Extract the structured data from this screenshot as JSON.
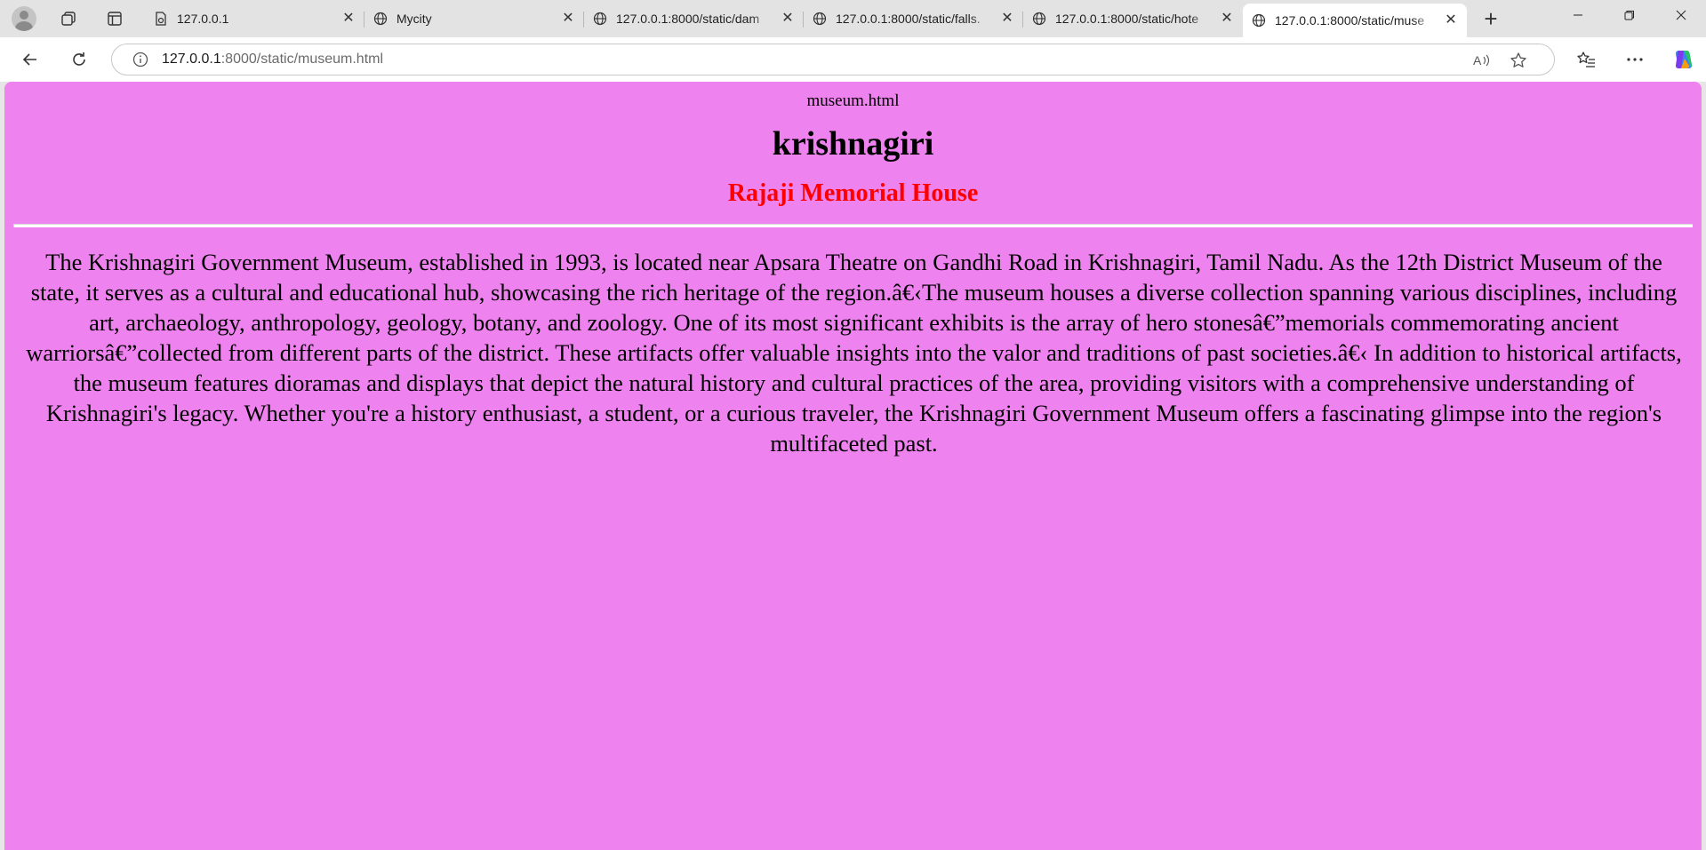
{
  "browser": {
    "tabs": [
      {
        "title": "127.0.0.1",
        "icon": "page-icon"
      },
      {
        "title": "Mycity",
        "icon": "globe-icon"
      },
      {
        "title": "127.0.0.1:8000/static/dam",
        "icon": "globe-icon"
      },
      {
        "title": "127.0.0.1:8000/static/falls.",
        "icon": "globe-icon"
      },
      {
        "title": "127.0.0.1:8000/static/hote",
        "icon": "globe-icon"
      },
      {
        "title": "127.0.0.1:8000/static/muse",
        "icon": "globe-icon",
        "active": true
      }
    ],
    "url_host": "127.0.0.1",
    "url_rest": ":8000/static/museum.html"
  },
  "page": {
    "doc_name": "museum.html",
    "heading": "krishnagiri",
    "subheading": "Rajaji Memorial House",
    "paragraph": "The Krishnagiri Government Museum, established in 1993, is located near Apsara Theatre on Gandhi Road in Krishnagiri, Tamil Nadu. As the 12th District Museum of the state, it serves as a cultural and educational hub, showcasing the rich heritage of the region.â€‹The museum houses a diverse collection spanning various disciplines, including art, archaeology, anthropology, geology, botany, and zoology. One of its most significant exhibits is the array of hero stonesâ€”memorials commemorating ancient warriorsâ€”collected from different parts of the district. These artifacts offer valuable insights into the valor and traditions of past societies.â€‹ In addition to historical artifacts, the museum features dioramas and displays that depict the natural history and cultural practices of the area, providing visitors with a comprehensive understanding of Krishnagiri's legacy. Whether you're a history enthusiast, a student, or a curious traveler, the Krishnagiri Government Museum offers a fascinating glimpse into the region's multifaceted past.",
    "background_color": "#ee82ee",
    "subheading_color": "#ff0000"
  }
}
